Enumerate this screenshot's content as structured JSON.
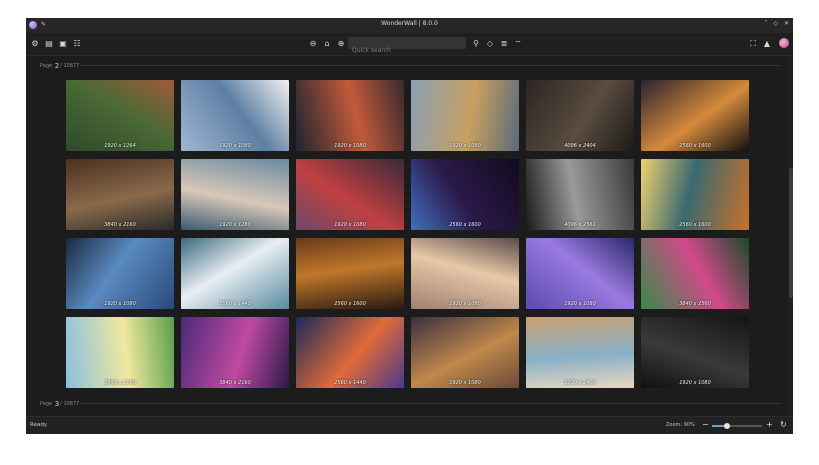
{
  "window": {
    "title": "WonderWall | 8.0.0"
  },
  "titlebar": {
    "pin_icon": "pin-icon",
    "controls": [
      "˅",
      "◇",
      "✕"
    ]
  },
  "toolbar": {
    "left_icons": [
      "gear-icon",
      "layout-icon",
      "bookmark-icon",
      "filter-sliders-icon"
    ],
    "center_icons": [
      "previous-icon",
      "home-icon",
      "next-icon"
    ],
    "search_placeholder": "Quick search",
    "right_search_icons": [
      "search-icon",
      "palette-icon",
      "sort-icon",
      "filter-icon"
    ],
    "right_icons": [
      "fullscreen-icon",
      "wallpaper-icon",
      "avatar"
    ]
  },
  "pages": [
    {
      "prefix": "Page",
      "number": "2",
      "total": "/ 10877"
    },
    {
      "prefix": "Page",
      "number": "3",
      "total": "/ 10877"
    }
  ],
  "thumbnails": [
    {
      "resolution": "1920 x 1264",
      "colors": [
        "#2f4a2a",
        "#4a6a35",
        "#a05a3a"
      ]
    },
    {
      "resolution": "1920 x 1080",
      "colors": [
        "#9fb7d2",
        "#5d7fa3",
        "#f2f2f2"
      ]
    },
    {
      "resolution": "1920 x 1080",
      "colors": [
        "#1c2430",
        "#c25a3a",
        "#3a2a30"
      ]
    },
    {
      "resolution": "1920 x 1080",
      "colors": [
        "#8aa0b3",
        "#c8a060",
        "#5a6a7a"
      ]
    },
    {
      "resolution": "4096 x 2404",
      "colors": [
        "#2b2622",
        "#5a4c40",
        "#1c1a18"
      ]
    },
    {
      "resolution": "2560 x 1600",
      "colors": [
        "#2b2230",
        "#d58a3a",
        "#121015"
      ]
    },
    {
      "resolution": "3840 x 2160",
      "colors": [
        "#4a3020",
        "#8a6a4a",
        "#2a2a2a"
      ]
    },
    {
      "resolution": "1920 x 1280",
      "colors": [
        "#6a8aa0",
        "#d8c8b8",
        "#3a5a70"
      ]
    },
    {
      "resolution": "1920 x 1080",
      "colors": [
        "#3a2a3a",
        "#c04040",
        "#6a4a6a"
      ]
    },
    {
      "resolution": "2560 x 1600",
      "colors": [
        "#120a1e",
        "#2a1a4a",
        "#4070c0"
      ]
    },
    {
      "resolution": "4096 x 2561",
      "colors": [
        "#3a3a3a",
        "#9a9a9a",
        "#1a1a1a"
      ]
    },
    {
      "resolution": "2560 x 1600",
      "colors": [
        "#c8702a",
        "#3a6a70",
        "#f0d070"
      ]
    },
    {
      "resolution": "1920 x 1080",
      "colors": [
        "#2a4a7a",
        "#5a8ac0",
        "#1a2a40"
      ]
    },
    {
      "resolution": "2560 x 1440",
      "colors": [
        "#5a8aa0",
        "#e8eef2",
        "#3a6a80"
      ]
    },
    {
      "resolution": "2560 x 1600",
      "colors": [
        "#2a1a12",
        "#c0782a",
        "#6a3a1a"
      ]
    },
    {
      "resolution": "1920 x 1080",
      "colors": [
        "#a08070",
        "#e8c8a8",
        "#5a4a4a"
      ]
    },
    {
      "resolution": "1920 x 1080",
      "colors": [
        "#5a4ab0",
        "#9a7ae0",
        "#2a2a6a"
      ]
    },
    {
      "resolution": "3840 x 2560",
      "colors": [
        "#3a8a4a",
        "#d04a8a",
        "#1a4a2a"
      ]
    },
    {
      "resolution": "3840 x 2160",
      "colors": [
        "#8ac0e0",
        "#f0e8a0",
        "#5aa04a"
      ]
    },
    {
      "resolution": "3840 x 2160",
      "colors": [
        "#4a2a7a",
        "#c04aa0",
        "#2a1a4a"
      ]
    },
    {
      "resolution": "2560 x 1440",
      "colors": [
        "#1a2a5a",
        "#e06a3a",
        "#4a3a8a"
      ]
    },
    {
      "resolution": "1920 x 1080",
      "colors": [
        "#3a3040",
        "#c0884a",
        "#6a4a3a"
      ]
    },
    {
      "resolution": "3200 x 2400",
      "colors": [
        "#c8a070",
        "#8ab0c8",
        "#e8d8c0"
      ]
    },
    {
      "resolution": "1920 x 1080",
      "colors": [
        "#151515",
        "#3a3a3a",
        "#101010"
      ]
    }
  ],
  "statusbar": {
    "status": "Ready",
    "zoom_label": "Zoom: 90%",
    "zoom_value": 0.3,
    "minus": "−",
    "plus": "+",
    "refresh": "↻"
  }
}
